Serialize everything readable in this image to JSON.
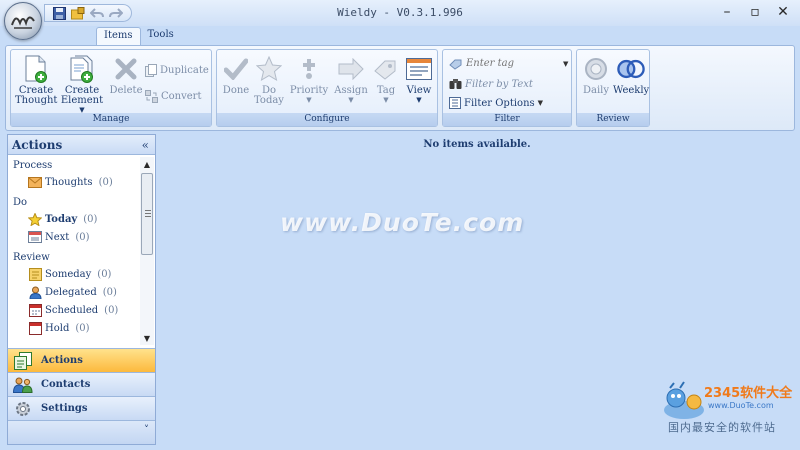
{
  "window": {
    "title": "Wieldy - V0.3.1.996"
  },
  "ribbon": {
    "tabs": [
      {
        "label": "Items"
      },
      {
        "label": "Tools"
      }
    ],
    "groups": {
      "manage": {
        "label": "Manage",
        "create_thought": "Create Thought",
        "create_element": "Create Element",
        "delete": "Delete",
        "duplicate": "Duplicate",
        "convert": "Convert"
      },
      "configure": {
        "label": "Configure",
        "done": "Done",
        "do_today": "Do Today",
        "priority": "Priority",
        "assign": "Assign",
        "tag": "Tag",
        "view": "View"
      },
      "filter": {
        "label": "Filter",
        "tag_placeholder": "Enter tag",
        "filter_by_text": "Filter by Text",
        "filter_options": "Filter Options"
      },
      "review": {
        "label": "Review",
        "daily": "Daily",
        "weekly": "Weekly"
      }
    }
  },
  "navpane": {
    "title": "Actions",
    "collapse": "«",
    "sections": {
      "process": {
        "label": "Process",
        "items": [
          {
            "label": "Thoughts",
            "count": "(0)"
          }
        ]
      },
      "do": {
        "label": "Do",
        "items": [
          {
            "label": "Today",
            "count": "(0)"
          },
          {
            "label": "Next",
            "count": "(0)"
          }
        ]
      },
      "review": {
        "label": "Review",
        "items": [
          {
            "label": "Someday",
            "count": "(0)"
          },
          {
            "label": "Delegated",
            "count": "(0)"
          },
          {
            "label": "Scheduled",
            "count": "(0)"
          },
          {
            "label": "Hold",
            "count": "(0)"
          }
        ]
      }
    },
    "buttons": [
      {
        "label": "Actions"
      },
      {
        "label": "Contacts"
      },
      {
        "label": "Settings"
      }
    ],
    "footer": "˅"
  },
  "main": {
    "empty_message": "No items available.",
    "watermark": "www.DuoTe.com"
  },
  "brand": {
    "name": "2345软件大全",
    "url": "www.DuoTe.com",
    "slogan": "国内最安全的软件站"
  }
}
